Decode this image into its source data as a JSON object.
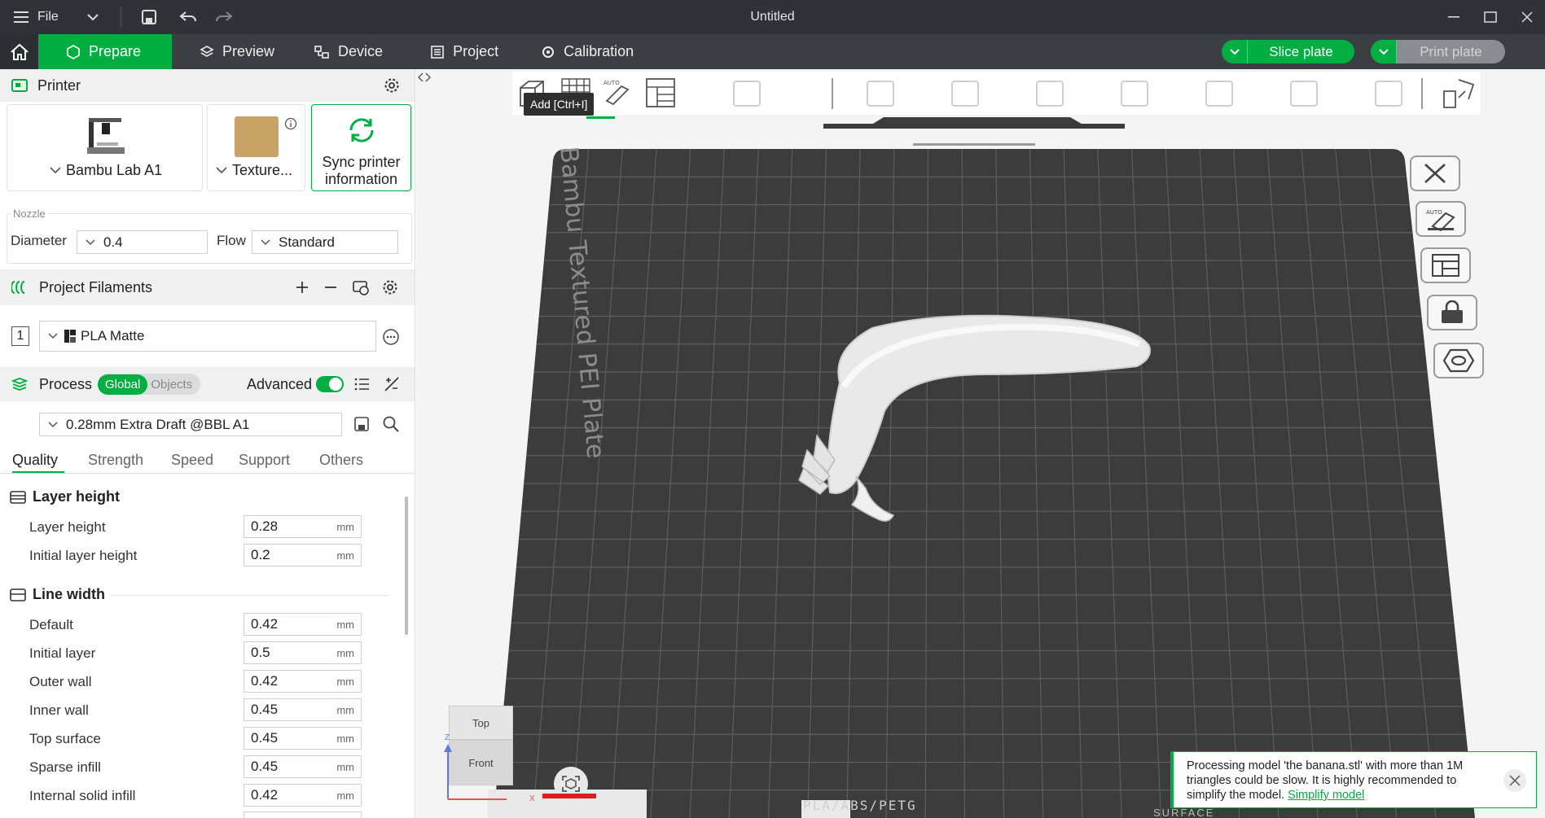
{
  "window": {
    "title": "Untitled",
    "file_menu": "File"
  },
  "nav": {
    "tabs": [
      {
        "label": "Prepare"
      },
      {
        "label": "Preview"
      },
      {
        "label": "Device"
      },
      {
        "label": "Project"
      },
      {
        "label": "Calibration"
      }
    ],
    "slice_button": "Slice plate",
    "print_button": "Print plate"
  },
  "printer": {
    "section_title": "Printer",
    "printer_name": "Bambu Lab A1",
    "plate_label": "Texture...",
    "sync_label_1": "Sync printer",
    "sync_label_2": "information",
    "nozzle_group": "Nozzle",
    "diameter_label": "Diameter",
    "diameter_value": "0.4",
    "flow_label": "Flow",
    "flow_value": "Standard"
  },
  "filaments": {
    "section_title": "Project Filaments",
    "items": [
      {
        "index": "1",
        "name": "PLA Matte"
      }
    ]
  },
  "process": {
    "section_title": "Process",
    "toggle_global": "Global",
    "toggle_objects": "Objects",
    "advanced_label": "Advanced",
    "profile": "0.28mm Extra Draft @BBL A1",
    "tabs": [
      "Quality",
      "Strength",
      "Speed",
      "Support",
      "Others"
    ],
    "groups": [
      {
        "title": "Layer height",
        "rows": [
          {
            "label": "Layer height",
            "value": "0.28",
            "unit": "mm"
          },
          {
            "label": "Initial layer height",
            "value": "0.2",
            "unit": "mm"
          }
        ]
      },
      {
        "title": "Line width",
        "rows": [
          {
            "label": "Default",
            "value": "0.42",
            "unit": "mm"
          },
          {
            "label": "Initial layer",
            "value": "0.5",
            "unit": "mm"
          },
          {
            "label": "Outer wall",
            "value": "0.42",
            "unit": "mm"
          },
          {
            "label": "Inner wall",
            "value": "0.45",
            "unit": "mm"
          },
          {
            "label": "Top surface",
            "value": "0.45",
            "unit": "mm"
          },
          {
            "label": "Sparse infill",
            "value": "0.45",
            "unit": "mm"
          },
          {
            "label": "Internal solid infill",
            "value": "0.42",
            "unit": "mm"
          }
        ]
      }
    ]
  },
  "viewport": {
    "tooltip": "Add [Ctrl+I]",
    "plate_name": "Bambu Textured PEI Plate",
    "filament_strip": "PLA/ABS/PETG",
    "surface_strip": "SURFACE",
    "cube_top": "Top",
    "cube_front": "Front",
    "axis_z": "Z",
    "axis_x": "X",
    "auto_label": "AUTO"
  },
  "notification": {
    "text": "Processing model 'the banana.stl' with more than 1M triangles could be slow. It is highly recommended to simplify the model.",
    "link": "Simplify model"
  },
  "colors": {
    "accent": "#00ae42",
    "titlebar": "#2f3236",
    "navbar": "#3b3e43",
    "plate": "#3c3c3c"
  }
}
